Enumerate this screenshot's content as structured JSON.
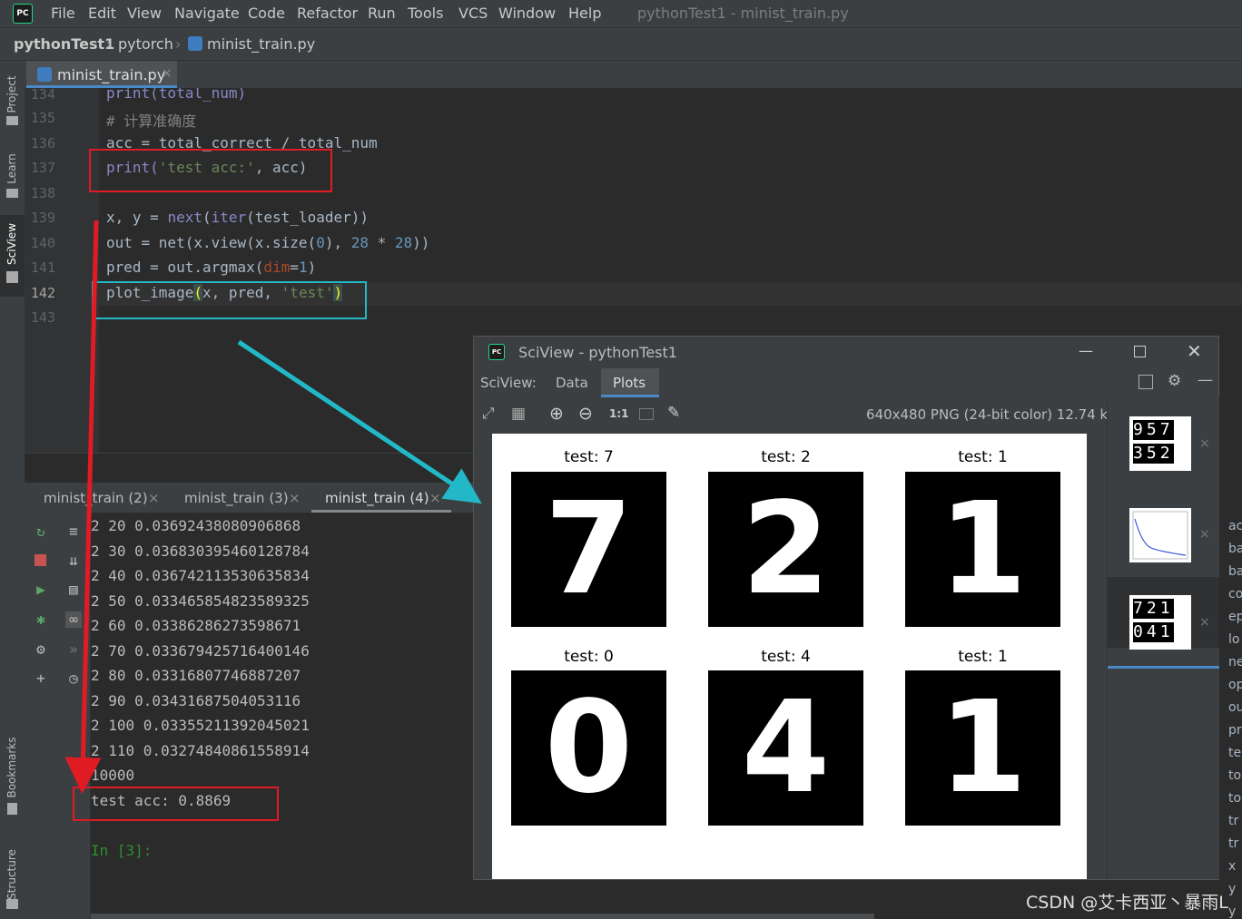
{
  "menubar": {
    "items": [
      "File",
      "Edit",
      "View",
      "Navigate",
      "Code",
      "Refactor",
      "Run",
      "Tools",
      "VCS",
      "Window",
      "Help"
    ],
    "window_title": "pythonTest1 - minist_train.py"
  },
  "breadcrumb": {
    "project": "pythonTest1",
    "folder": "pytorch",
    "file": "minist_train.py"
  },
  "left_tabs": [
    "Project",
    "Learn",
    "SciView",
    "Bookmarks",
    "Structure"
  ],
  "editor": {
    "tab_label": "minist_train.py",
    "line_numbers": [
      "134",
      "135",
      "136",
      "137",
      "138",
      "139",
      "140",
      "141",
      "142",
      "143"
    ],
    "lines": {
      "l134": "print(total_num)",
      "l135": "# 计算准确度",
      "l136": "acc = total_correct / total_num",
      "l137_a": "print(",
      "l137_b": "'test acc:'",
      "l137_c": ", acc)",
      "l139_a": "x, y = ",
      "l139_b": "next",
      "l139_c": "(",
      "l139_d": "iter",
      "l139_e": "(test_loader))",
      "l140_a": "out = net(x.view(x.size(",
      "l140_b": "0",
      "l140_c": "), ",
      "l140_d": "28",
      "l140_e": " * ",
      "l140_f": "28",
      "l140_g": "))",
      "l141_a": "pred = out.argmax(",
      "l141_b": "dim",
      "l141_c": "=",
      "l141_d": "1",
      "l141_e": ")",
      "l142_a": "plot_image",
      "l142_b": "(",
      "l142_c": "x, pred, ",
      "l142_d": "'test'",
      "l142_e": ")"
    }
  },
  "console": {
    "tabs": [
      "minist_train (2)",
      "minist_train (3)",
      "minist_train (4)"
    ],
    "output": [
      "2 20 0.03692438080906868",
      "2 30 0.036830395460128784",
      "2 40 0.036742113530635834",
      "2 50 0.033465854823589325",
      "2 60 0.03386286273598671",
      "2 70 0.033679425716400146",
      "2 80 0.03316807746887207",
      "2 90 0.03431687504053116",
      "2 100 0.03355211392045021",
      "2 110 0.032748408615589​14",
      "10000",
      "test acc: 0.8869"
    ],
    "prompt": "In [3]:"
  },
  "sciview": {
    "window_title": "SciView - pythonTest1",
    "label": "SciView:",
    "tabs": [
      "Data",
      "Plots"
    ],
    "active_tab": "Plots",
    "image_info": "640x480 PNG (24-bit color) 12.74 kB",
    "zoom_label": "1:1",
    "plots": [
      {
        "title": "test: 7",
        "digit": "7"
      },
      {
        "title": "test: 2",
        "digit": "2"
      },
      {
        "title": "test: 1",
        "digit": "1"
      },
      {
        "title": "test: 0",
        "digit": "0"
      },
      {
        "title": "test: 4",
        "digit": "4"
      },
      {
        "title": "test: 1",
        "digit": "1"
      }
    ],
    "thumb_digits": {
      "t1": [
        "9",
        "5",
        "7",
        "3",
        "5",
        "2"
      ],
      "t3": [
        "7",
        "2",
        "1",
        "0",
        "4",
        "1"
      ]
    }
  },
  "right_panel": [
    "ac",
    "ba",
    "ba",
    "co",
    "ep",
    "lo",
    "ne",
    "op",
    "ou",
    "pr",
    "te",
    "to",
    "to",
    "tr",
    "tr",
    "x",
    "y",
    "y"
  ],
  "watermark": "CSDN @艾卡西亚丶暴雨L",
  "colors": {
    "annotation_red": "#e01b24",
    "annotation_cyan": "#22b8c8",
    "accent": "#4a88c7"
  }
}
